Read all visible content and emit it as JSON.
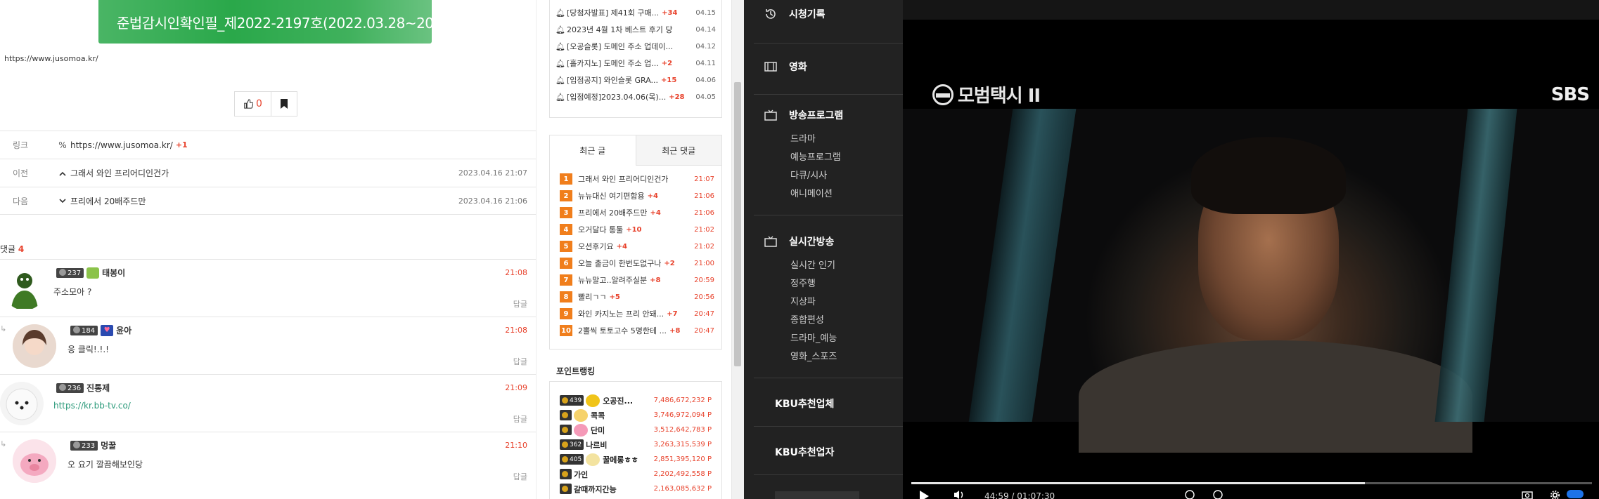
{
  "article": {
    "banner_text": "준법감시인확인필_제2022-2197호(2022.03.28~202",
    "url": "https://www.jusomoa.kr/",
    "like_count": "0",
    "link_row": {
      "label": "링크",
      "value": "https://www.jusomoa.kr/",
      "plus": "+1"
    },
    "prev_row": {
      "label": "이전",
      "title": "그래서 와인 프리어디인건가",
      "date": "2023.04.16 21:07"
    },
    "next_row": {
      "label": "다음",
      "title": "프리에서 20배주드만",
      "date": "2023.04.16 21:06"
    },
    "comments_label": "댓글",
    "comments_count": "4"
  },
  "comments": [
    {
      "level": "237",
      "nick": "태봉이",
      "time": "21:08",
      "text": "주소모아 ?",
      "reply": "답글",
      "is_reply": false
    },
    {
      "level": "184",
      "nick": "윤아",
      "time": "21:08",
      "text": "응 클릭!.!.!",
      "reply": "답글",
      "is_reply": true
    },
    {
      "level": "236",
      "nick": "진통제",
      "time": "21:09",
      "text": "https://kr.bb-tv.co/",
      "reply": "답글",
      "is_reply": false
    },
    {
      "level": "233",
      "nick": "멍꿀",
      "time": "21:10",
      "text": "오 요기 깔끔해보인당",
      "reply": "답글",
      "is_reply": true
    }
  ],
  "notices": [
    {
      "title": "[당첨자발표] 제41회 구매...",
      "count": "+34",
      "date": "04.15"
    },
    {
      "title": "2023년 4월 1차 베스트 후기 당...",
      "count": "",
      "date": "04.14"
    },
    {
      "title": "[오공슬롯] 도메인 주소 업데이...",
      "count": "",
      "date": "04.12"
    },
    {
      "title": "[홀카지노] 도메인 주소 업...",
      "count": "+2",
      "date": "04.11"
    },
    {
      "title": "[입점공지] 와인슬롯 GRA...",
      "count": "+15",
      "date": "04.06"
    },
    {
      "title": "[입점예정]2023.04.06(목)...",
      "count": "+28",
      "date": "04.05"
    }
  ],
  "recent": {
    "tab_posts": "최근 글",
    "tab_comments": "최근 댓글",
    "items": [
      {
        "rank": "1",
        "title": "그래서 와인 프리어디인건가",
        "count": "",
        "time": "21:07"
      },
      {
        "rank": "2",
        "title": "뉴뉴대신 여기편함용",
        "count": "+4",
        "time": "21:06"
      },
      {
        "rank": "3",
        "title": "프리에서 20배주드만",
        "count": "+4",
        "time": "21:06"
      },
      {
        "rank": "4",
        "title": "오거달다 통툴",
        "count": "+10",
        "time": "21:02"
      },
      {
        "rank": "5",
        "title": "오션후기요",
        "count": "+4",
        "time": "21:02"
      },
      {
        "rank": "6",
        "title": "오늘 출금이 한번도없구나",
        "count": "+2",
        "time": "21:00"
      },
      {
        "rank": "7",
        "title": "뉴뉴말고..알려주실분",
        "count": "+8",
        "time": "20:59"
      },
      {
        "rank": "8",
        "title": "빨리ㄱㄱ",
        "count": "+5",
        "time": "20:56"
      },
      {
        "rank": "9",
        "title": "와인 카지노는 프리 안돼...",
        "count": "+7",
        "time": "20:47"
      },
      {
        "rank": "10",
        "title": "2뽈씩 토토고수 5명한테 ...",
        "count": "+8",
        "time": "20:47"
      }
    ]
  },
  "point_ranking": {
    "title": "포인트랭킹",
    "items": [
      {
        "level": "439",
        "nick": "오공진...",
        "points": "7,486,672,232 P",
        "icon_color": "#f0c419"
      },
      {
        "level": "",
        "nick": "콕콕",
        "points": "3,746,972,094 P",
        "icon_color": "#f6d26b"
      },
      {
        "level": "",
        "nick": "단미",
        "points": "3,512,642,783 P",
        "icon_color": "#f59ab8"
      },
      {
        "level": "362",
        "nick": "나르비",
        "points": "3,263,315,539 P",
        "icon_color": ""
      },
      {
        "level": "405",
        "nick": "꿀메롱ㅎㅎ",
        "points": "2,851,395,120 P",
        "icon_color": "#f3e3a0"
      },
      {
        "level": "",
        "nick": "가인",
        "points": "2,202,492,558 P",
        "icon_color": ""
      },
      {
        "level": "",
        "nick": "갈때까지간능",
        "points": "2,163,085,632 P",
        "icon_color": ""
      }
    ]
  },
  "nav": {
    "history": "시청기록",
    "movies": "영화",
    "broadcast": "방송프로그램",
    "broadcast_items": [
      "드라마",
      "예능프로그램",
      "다큐/시사",
      "애니메이션"
    ],
    "live": "실시간방송",
    "live_items": [
      "실시간 인기",
      "정주행",
      "지상파",
      "종합편성",
      "드라마_예능",
      "영화_스포즈"
    ],
    "kbu_company": "KBU추천업체",
    "kbu_dealer": "KBU추천업자"
  },
  "video": {
    "show_title": "모범택시 II",
    "channel": "SBS",
    "time_display": "44:59 / 01:07:30",
    "progress_fraction": 0.666
  }
}
